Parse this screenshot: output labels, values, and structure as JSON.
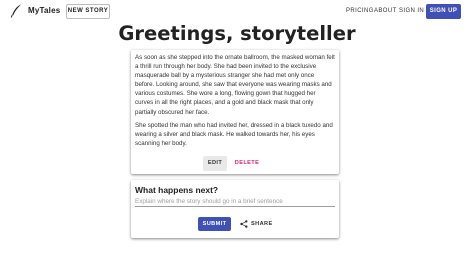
{
  "header": {
    "brand": "MyTales",
    "new_story_label": "NEW STORY",
    "nav": {
      "pricing": "PRICING",
      "about": "ABOUT",
      "sign_in": "SIGN IN",
      "sign_up": "SIGN UP"
    },
    "logo_icon": "quill-pen-icon"
  },
  "main": {
    "title": "Greetings, storyteller"
  },
  "story": {
    "paragraphs": [
      "As soon as she stepped into the ornate ballroom, the masked woman felt a thrill run through her body. She had been invited to the exclusive masquerade ball by a mysterious stranger she had met only once before. Looking around, she saw that everyone was wearing masks and various costumes. She wore a long, flowing gown that hugged her curves in all the right places, and a gold and black mask that only partially obscured her face.",
      "She spotted the man who had invited her, dressed in a black tuxedo and wearing a silver and black mask. He walked towards her, his eyes scanning her body."
    ],
    "edit_label": "EDIT",
    "delete_label": "DELETE"
  },
  "next": {
    "title": "What happens next?",
    "input_value": "",
    "input_placeholder": "Explain where the story should go in a brief sentence",
    "submit_label": "SUBMIT",
    "share_label": "SHARE",
    "share_icon": "share-icon"
  },
  "colors": {
    "primary": "#3f51b5",
    "delete": "#e91e63"
  }
}
